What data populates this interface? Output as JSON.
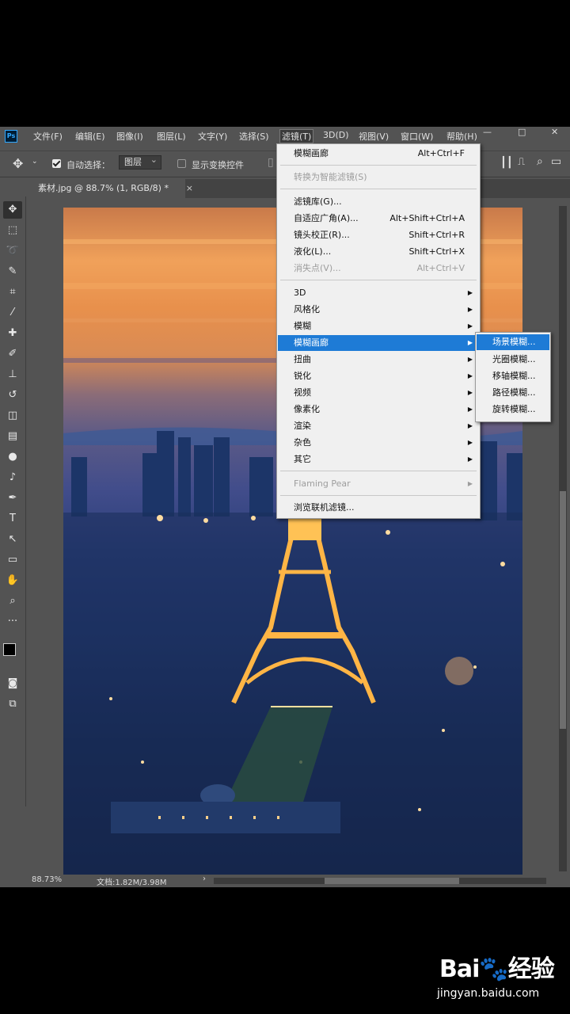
{
  "app": {
    "logo_text": "Ps"
  },
  "menubar": {
    "items": [
      "文件(F)",
      "编辑(E)",
      "图像(I)",
      "图层(L)",
      "文字(Y)",
      "选择(S)",
      "滤镜(T)",
      "3D(D)",
      "视图(V)",
      "窗口(W)",
      "帮助(H)"
    ],
    "active_index": 6
  },
  "options_bar": {
    "auto_select_label": "自动选择：",
    "auto_select_checked": true,
    "auto_select_value": "图层",
    "show_transform_label": "显示变换控件",
    "show_transform_checked": false
  },
  "document": {
    "tab_title": "素材.jpg @ 88.7% (1, RGB/8) *",
    "close_glyph": "×"
  },
  "status": {
    "zoom": "88.73%",
    "doc_info": "文档:1.82M/3.98M"
  },
  "filter_menu": {
    "items": [
      {
        "label": "模糊画廊",
        "shortcut": "Alt+Ctrl+F"
      },
      {
        "label": "转换为智能滤镜(S)",
        "disabled": true
      },
      {
        "label": "滤镜库(G)..."
      },
      {
        "label": "自适应广角(A)...",
        "shortcut": "Alt+Shift+Ctrl+A"
      },
      {
        "label": "镜头校正(R)...",
        "shortcut": "Shift+Ctrl+R"
      },
      {
        "label": "液化(L)...",
        "shortcut": "Shift+Ctrl+X"
      },
      {
        "label": "消失点(V)...",
        "shortcut": "Alt+Ctrl+V",
        "disabled": true
      },
      {
        "label": "3D",
        "submenu": true
      },
      {
        "label": "风格化",
        "submenu": true
      },
      {
        "label": "模糊",
        "submenu": true
      },
      {
        "label": "模糊画廊",
        "submenu": true,
        "highlighted": true
      },
      {
        "label": "扭曲",
        "submenu": true
      },
      {
        "label": "锐化",
        "submenu": true
      },
      {
        "label": "视频",
        "submenu": true
      },
      {
        "label": "像素化",
        "submenu": true
      },
      {
        "label": "渲染",
        "submenu": true
      },
      {
        "label": "杂色",
        "submenu": true
      },
      {
        "label": "其它",
        "submenu": true
      },
      {
        "label": "Flaming Pear",
        "submenu": true,
        "disabled": true
      },
      {
        "label": "浏览联机滤镜..."
      }
    ]
  },
  "blur_gallery_submenu": {
    "items": [
      "场景模糊...",
      "光圈模糊...",
      "移轴模糊...",
      "路径模糊...",
      "旋转模糊..."
    ],
    "highlighted_index": 0
  },
  "watermark": {
    "logo_text": "Bai🐾经验",
    "url": "jingyan.baidu.com"
  },
  "colors": {
    "ui_bg": "#535353",
    "menu_bg": "#f0f0f0",
    "highlight": "#1e7bd6"
  }
}
